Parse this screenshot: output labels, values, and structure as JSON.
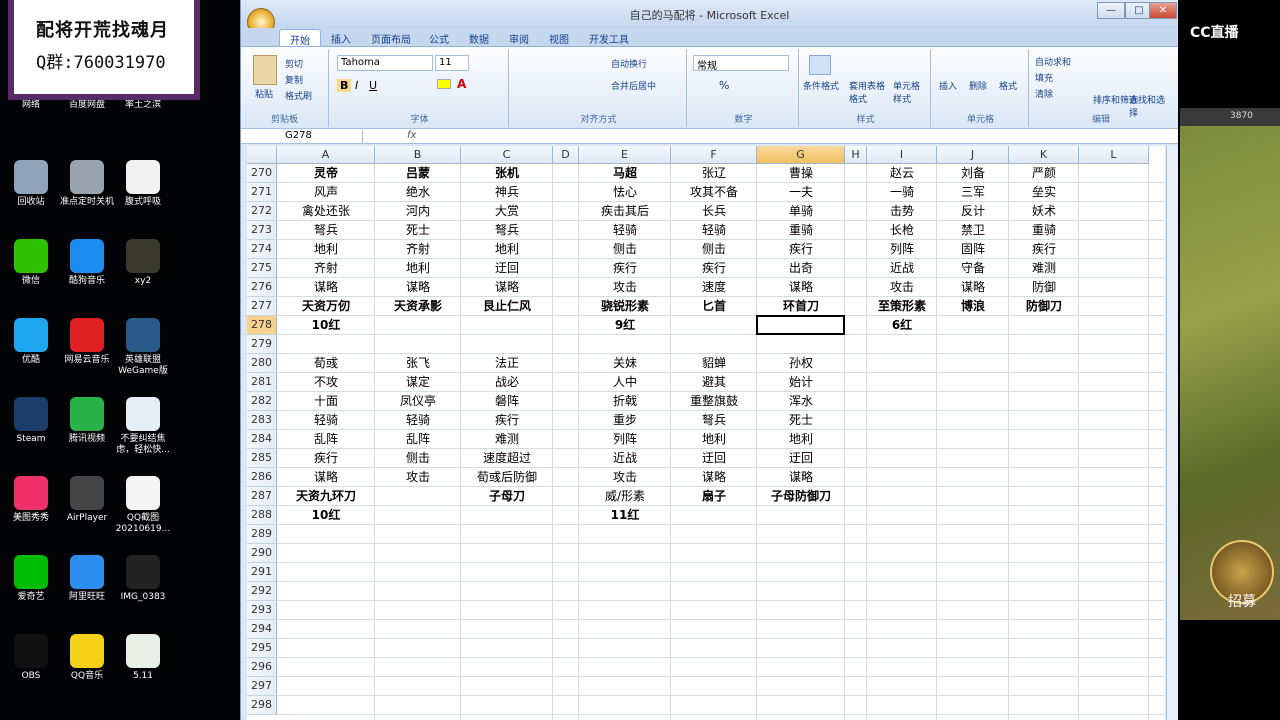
{
  "overlay": {
    "line1": "配将开荒找魂月",
    "line2": "Q群:760031970"
  },
  "desktop_icons": [
    {
      "label": "网络",
      "icon": "network-icon",
      "color": "#2e6fd1"
    },
    {
      "label": "百度网盘",
      "icon": "baidu-netdisk-icon",
      "color": "#2f8cf0"
    },
    {
      "label": "率土之滨",
      "icon": "game-icon",
      "color": "#b23a2a"
    },
    {
      "label": "回收站",
      "icon": "recycle-bin-icon",
      "color": "#8fa3b8"
    },
    {
      "label": "准点定时关机",
      "icon": "power-icon",
      "color": "#9aa4b0"
    },
    {
      "label": "腹式呼吸",
      "icon": "document-icon",
      "color": "#f2f2f2"
    },
    {
      "label": "微信",
      "icon": "wechat-icon",
      "color": "#2dc100"
    },
    {
      "label": "酷狗音乐",
      "icon": "kugou-icon",
      "color": "#1d8cf0"
    },
    {
      "label": "xy2",
      "icon": "xy2-icon",
      "color": "#3a3a2a"
    },
    {
      "label": "优酷",
      "icon": "youku-icon",
      "color": "#1fa6f0"
    },
    {
      "label": "网易云音乐",
      "icon": "netease-music-icon",
      "color": "#e02020"
    },
    {
      "label": "英雄联盟WeGame版",
      "icon": "lol-icon",
      "color": "#2a5a8a"
    },
    {
      "label": "Steam",
      "icon": "steam-icon",
      "color": "#1b3d6a"
    },
    {
      "label": "腾讯视频",
      "icon": "tencent-video-icon",
      "color": "#29b14a"
    },
    {
      "label": "不要纠结焦虑，轻松快...",
      "icon": "word-doc-icon",
      "color": "#e8eef8"
    },
    {
      "label": "美图秀秀",
      "icon": "meitu-icon",
      "color": "#f0306a"
    },
    {
      "label": "AirPlayer",
      "icon": "airplayer-icon",
      "color": "#444"
    },
    {
      "label": "QQ截图20210619...",
      "icon": "image-file-icon",
      "color": "#f4f4f4"
    },
    {
      "label": "爱奇艺",
      "icon": "iqiyi-icon",
      "color": "#00be06"
    },
    {
      "label": "阿里旺旺",
      "icon": "aliwangwang-icon",
      "color": "#2b8ef0"
    },
    {
      "label": "IMG_0383",
      "icon": "image-file-icon",
      "color": "#222"
    },
    {
      "label": "OBS",
      "icon": "obs-icon",
      "color": "#111"
    },
    {
      "label": "QQ音乐",
      "icon": "qq-music-icon",
      "color": "#f5d118"
    },
    {
      "label": "5.11",
      "icon": "excel-file-icon",
      "color": "#e8f0e8"
    }
  ],
  "excel": {
    "title": "自己的马配将 - Microsoft Excel",
    "window_buttons": [
      "—",
      "□",
      "✕"
    ],
    "tabs": [
      "开始",
      "插入",
      "页面布局",
      "公式",
      "数据",
      "审阅",
      "视图",
      "开发工具"
    ],
    "font_name": "Tahoma",
    "font_size": "11",
    "number_format": "常规",
    "groups": [
      "剪贴板",
      "字体",
      "对齐方式",
      "数字",
      "样式",
      "单元格",
      "编辑"
    ],
    "buttons": {
      "paste": "粘贴",
      "cut": "剪切",
      "copy": "复制",
      "format_painter": "格式刷",
      "wrap": "自动换行",
      "merge": "合并后居中",
      "cond_format": "条件格式",
      "table_format": "套用表格格式",
      "cell_style": "单元格样式",
      "insert": "插入",
      "delete": "删除",
      "format": "格式",
      "autosum": "自动求和",
      "fill": "填充",
      "clear": "清除",
      "sort": "排序和筛选",
      "find": "查找和选择"
    },
    "name_box": "G278",
    "fx": "fx",
    "columns": [
      "A",
      "B",
      "C",
      "D",
      "E",
      "F",
      "G",
      "H",
      "I",
      "J",
      "K",
      "L"
    ],
    "selected_column": "G",
    "selected_row": "278",
    "rows": [
      {
        "n": "270",
        "cells": [
          "灵帝",
          "吕蒙",
          "张机",
          "",
          "马超",
          "张辽",
          "曹操",
          "",
          "赵云",
          "刘备",
          "严颜",
          ""
        ],
        "bold": [
          0,
          1,
          2,
          4
        ]
      },
      {
        "n": "271",
        "cells": [
          "风声",
          "绝水",
          "神兵",
          "",
          "怯心",
          "攻其不备",
          "一夫",
          "",
          "一骑",
          "三军",
          "垒实",
          ""
        ]
      },
      {
        "n": "272",
        "cells": [
          "禽处还张",
          "河内",
          "大赏",
          "",
          "疾击其后",
          "长兵",
          "单骑",
          "",
          "击势",
          "反计",
          "妖术",
          ""
        ]
      },
      {
        "n": "273",
        "cells": [
          "弩兵",
          "死士",
          "弩兵",
          "",
          "轻骑",
          "轻骑",
          "重骑",
          "",
          "长枪",
          "禁卫",
          "重骑",
          ""
        ]
      },
      {
        "n": "274",
        "cells": [
          "地利",
          "齐射",
          "地利",
          "",
          "侧击",
          "侧击",
          "疾行",
          "",
          "列阵",
          "固阵",
          "疾行",
          ""
        ]
      },
      {
        "n": "275",
        "cells": [
          "齐射",
          "地利",
          "迂回",
          "",
          "疾行",
          "疾行",
          "出奇",
          "",
          "近战",
          "守备",
          "难测",
          ""
        ]
      },
      {
        "n": "276",
        "cells": [
          "谋略",
          "谋略",
          "谋略",
          "",
          "攻击",
          "速度",
          "谋略",
          "",
          "攻击",
          "谋略",
          "防御",
          ""
        ]
      },
      {
        "n": "277",
        "cells": [
          "天资万仞",
          "天资承影",
          "艮止仁风",
          "",
          "骁锐形素",
          "匕首",
          "环首刀",
          "",
          "至策形素",
          "博浪",
          "防御刀",
          ""
        ],
        "bold": [
          0,
          1,
          2,
          4,
          5,
          6,
          8,
          9,
          10
        ]
      },
      {
        "n": "278",
        "cells": [
          "10红",
          "",
          "",
          "",
          "9红",
          "",
          "",
          "",
          "6红",
          "",
          "",
          ""
        ],
        "bold": [
          0,
          4,
          8
        ]
      },
      {
        "n": "279",
        "cells": [
          "",
          "",
          "",
          "",
          "",
          "",
          "",
          "",
          "",
          "",
          "",
          ""
        ]
      },
      {
        "n": "280",
        "cells": [
          "荀彧",
          "张飞",
          "法正",
          "",
          "关妹",
          "貂蝉",
          "孙权",
          "",
          "",
          "",
          "",
          ""
        ]
      },
      {
        "n": "281",
        "cells": [
          "不攻",
          "谋定",
          "战必",
          "",
          "人中",
          "避其",
          "始计",
          "",
          "",
          "",
          "",
          ""
        ]
      },
      {
        "n": "282",
        "cells": [
          "十面",
          "凤仪亭",
          "磐阵",
          "",
          "折戟",
          "重整旗鼓",
          "浑水",
          "",
          "",
          "",
          "",
          ""
        ]
      },
      {
        "n": "283",
        "cells": [
          "轻骑",
          "轻骑",
          "疾行",
          "",
          "重步",
          "弩兵",
          "死士",
          "",
          "",
          "",
          "",
          ""
        ]
      },
      {
        "n": "284",
        "cells": [
          "乱阵",
          "乱阵",
          "难测",
          "",
          "列阵",
          "地利",
          "地利",
          "",
          "",
          "",
          "",
          ""
        ]
      },
      {
        "n": "285",
        "cells": [
          "疾行",
          "侧击",
          "速度超过",
          "",
          "近战",
          "迂回",
          "迂回",
          "",
          "",
          "",
          "",
          ""
        ]
      },
      {
        "n": "286",
        "cells": [
          "谋略",
          "攻击",
          "荀彧后防御",
          "",
          "攻击",
          "谋略",
          "谋略",
          "",
          "",
          "",
          "",
          ""
        ]
      },
      {
        "n": "287",
        "cells": [
          "天资九环刀",
          "",
          "子母刀",
          "",
          "威/形素",
          "扇子",
          "子母防御刀",
          "",
          "",
          "",
          "",
          ""
        ],
        "bold": [
          0,
          2,
          5,
          6
        ]
      },
      {
        "n": "288",
        "cells": [
          "10红",
          "",
          "",
          "",
          "11红",
          "",
          "",
          "",
          "",
          "",
          "",
          ""
        ],
        "bold": [
          0,
          4
        ]
      },
      {
        "n": "289",
        "cells": []
      },
      {
        "n": "290",
        "cells": []
      },
      {
        "n": "291",
        "cells": []
      },
      {
        "n": "292",
        "cells": []
      },
      {
        "n": "293",
        "cells": []
      },
      {
        "n": "294",
        "cells": []
      },
      {
        "n": "295",
        "cells": []
      },
      {
        "n": "296",
        "cells": []
      },
      {
        "n": "297",
        "cells": []
      },
      {
        "n": "298",
        "cells": []
      }
    ]
  },
  "stream": {
    "logo": "CC直播",
    "currency": "3870",
    "recruit": "招募"
  }
}
